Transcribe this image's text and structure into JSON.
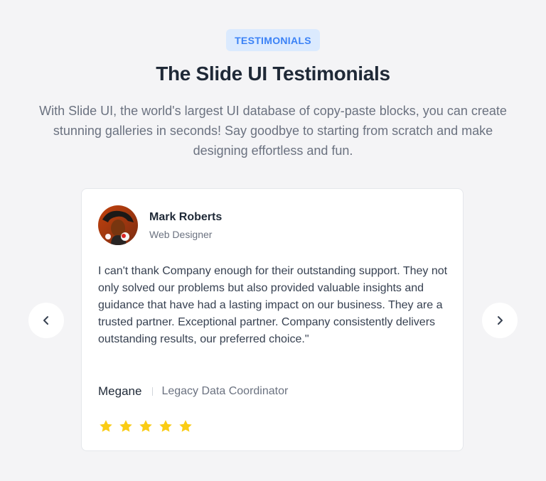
{
  "header": {
    "badge": "TESTIMONIALS",
    "title": "The Slide UI Testimonials",
    "subtitle": "With Slide UI, the world's largest UI database of copy-paste blocks, you can create stunning galleries in seconds! Say goodbye to starting from scratch and make designing effortless and fun."
  },
  "testimonial": {
    "author_name": "Mark Roberts",
    "author_role": "Web Designer",
    "quote": "I can't thank Company enough for their outstanding support. They not only solved our problems but also provided valuable insights and guidance that have had a lasting impact on our business. They are a trusted partner. Exceptional partner. Company consistently delivers outstanding results, our preferred choice.\"",
    "reference_name": "Megane",
    "reference_title": "Legacy Data Coordinator",
    "rating": 5,
    "rating_max": 5
  },
  "navigation": {
    "prev_icon": "chevron-left-icon",
    "next_icon": "chevron-right-icon"
  },
  "colors": {
    "background": "#f4f4f6",
    "badge_bg": "#dbeafe",
    "badge_text": "#3b82f6",
    "star": "#facc15"
  }
}
